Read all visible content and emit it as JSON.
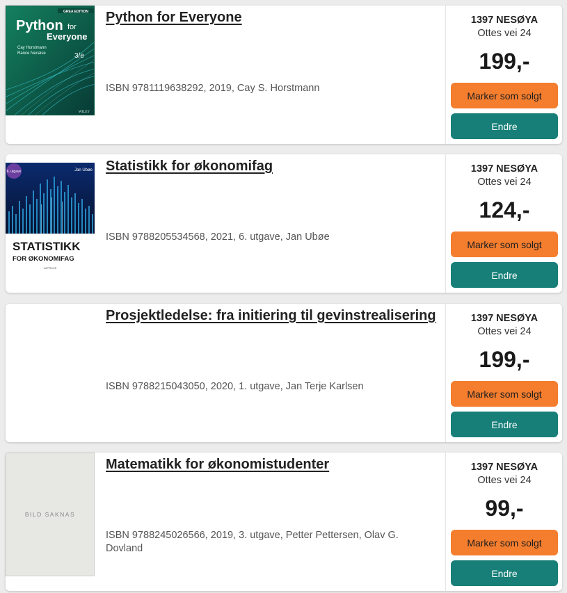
{
  "listings": [
    {
      "title": "Python for Everyone",
      "meta": "ISBN 9781119638292, 2019, Cay S. Horstmann",
      "location_code": "1397 NESØYA",
      "location_address": "Ottes vei 24",
      "price": "199,-",
      "sold_label": "Marker som solgt",
      "edit_label": "Endre",
      "cover": {
        "edition_badge": "GREA EDITION",
        "title_line1": "Python",
        "title_for": "for",
        "title_line2": "Everyone",
        "authors_line1": "Cay Horstmann",
        "authors_line2": "Rance Necaise",
        "edition": "3/e",
        "publisher": "WILEY"
      }
    },
    {
      "title": "Statistikk for økonomifag",
      "meta": "ISBN 9788205534568, 2021, 6. utgave, Jan Ubøe",
      "location_code": "1397 NESØYA",
      "location_address": "Ottes vei 24",
      "price": "124,-",
      "sold_label": "Marker som solgt",
      "edit_label": "Endre",
      "cover": {
        "badge": "6. utgave",
        "author": "Jan Ubøe",
        "title_line1": "STATISTIKK",
        "title_line2": "FOR ØKONOMIFAG",
        "publisher": "CAPPELEN"
      }
    },
    {
      "title": "Prosjektledelse: fra initiering til gevinstrealisering",
      "meta": "ISBN 9788215043050, 2020, 1. utgave, Jan Terje Karlsen",
      "location_code": "1397 NESØYA",
      "location_address": "Ottes vei 24",
      "price": "199,-",
      "sold_label": "Marker som solgt",
      "edit_label": "Endre"
    },
    {
      "title": "Matematikk for økonomistudenter",
      "meta": "ISBN 9788245026566, 2019, 3. utgave, Petter Pettersen, Olav G. Dovland",
      "location_code": "1397 NESØYA",
      "location_address": "Ottes vei 24",
      "price": "99,-",
      "sold_label": "Marker som solgt",
      "edit_label": "Endre",
      "cover": {
        "missing_text": "BILD SAKNAS"
      }
    }
  ],
  "colors": {
    "sold_button": "#f47d2e",
    "edit_button": "#177f78",
    "python_cover": "#0e6b4f",
    "stat_bars": "#2a9bd6"
  }
}
